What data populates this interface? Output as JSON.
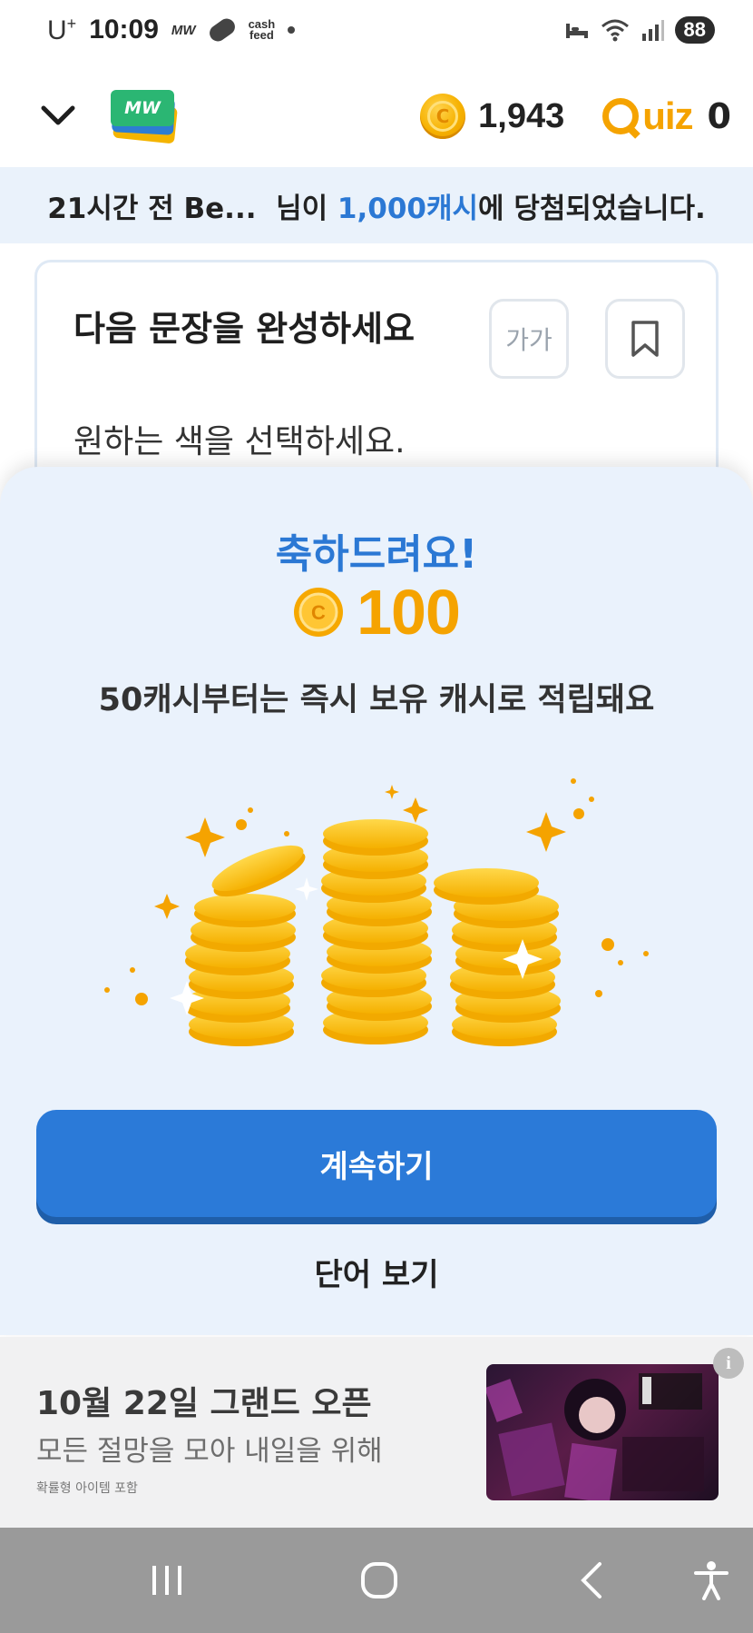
{
  "status_bar": {
    "carrier": "U",
    "carrier_sup": "+",
    "time": "10:09",
    "mw_label": "MW",
    "cashfeed_line1": "cash",
    "cashfeed_line2": "feed",
    "battery": "88"
  },
  "header": {
    "logo_text": "MW",
    "coin_symbol": "C",
    "balance": "1,943",
    "quiz_label": "uiz",
    "quiz_count": "0"
  },
  "winner_banner": {
    "prefix": "21시간 전 Be...  님이 ",
    "highlight": "1,000캐시",
    "suffix": "에 당첨되었습니다."
  },
  "question_card": {
    "title": "다음 문장을 완성하세요",
    "font_size_label": "가가",
    "subtitle": "원하는 색을 선택하세요."
  },
  "reward_sheet": {
    "congrats": "축하드려요!",
    "coin_symbol": "C",
    "amount": "100",
    "description": "50캐시부터는 즉시 보유 캐시로 적립돼요",
    "continue_label": "계속하기",
    "view_words_label": "단어 보기"
  },
  "ad": {
    "title": "10월 22일 그랜드 오픈",
    "subtitle": "모든 절망을 모아 내일을 위해",
    "note": "확률형 아이템 포함",
    "info_symbol": "i"
  },
  "colors": {
    "accent_blue": "#2b78d4",
    "coin_orange": "#f5a300",
    "sheet_bg": "#eaf2fc"
  }
}
